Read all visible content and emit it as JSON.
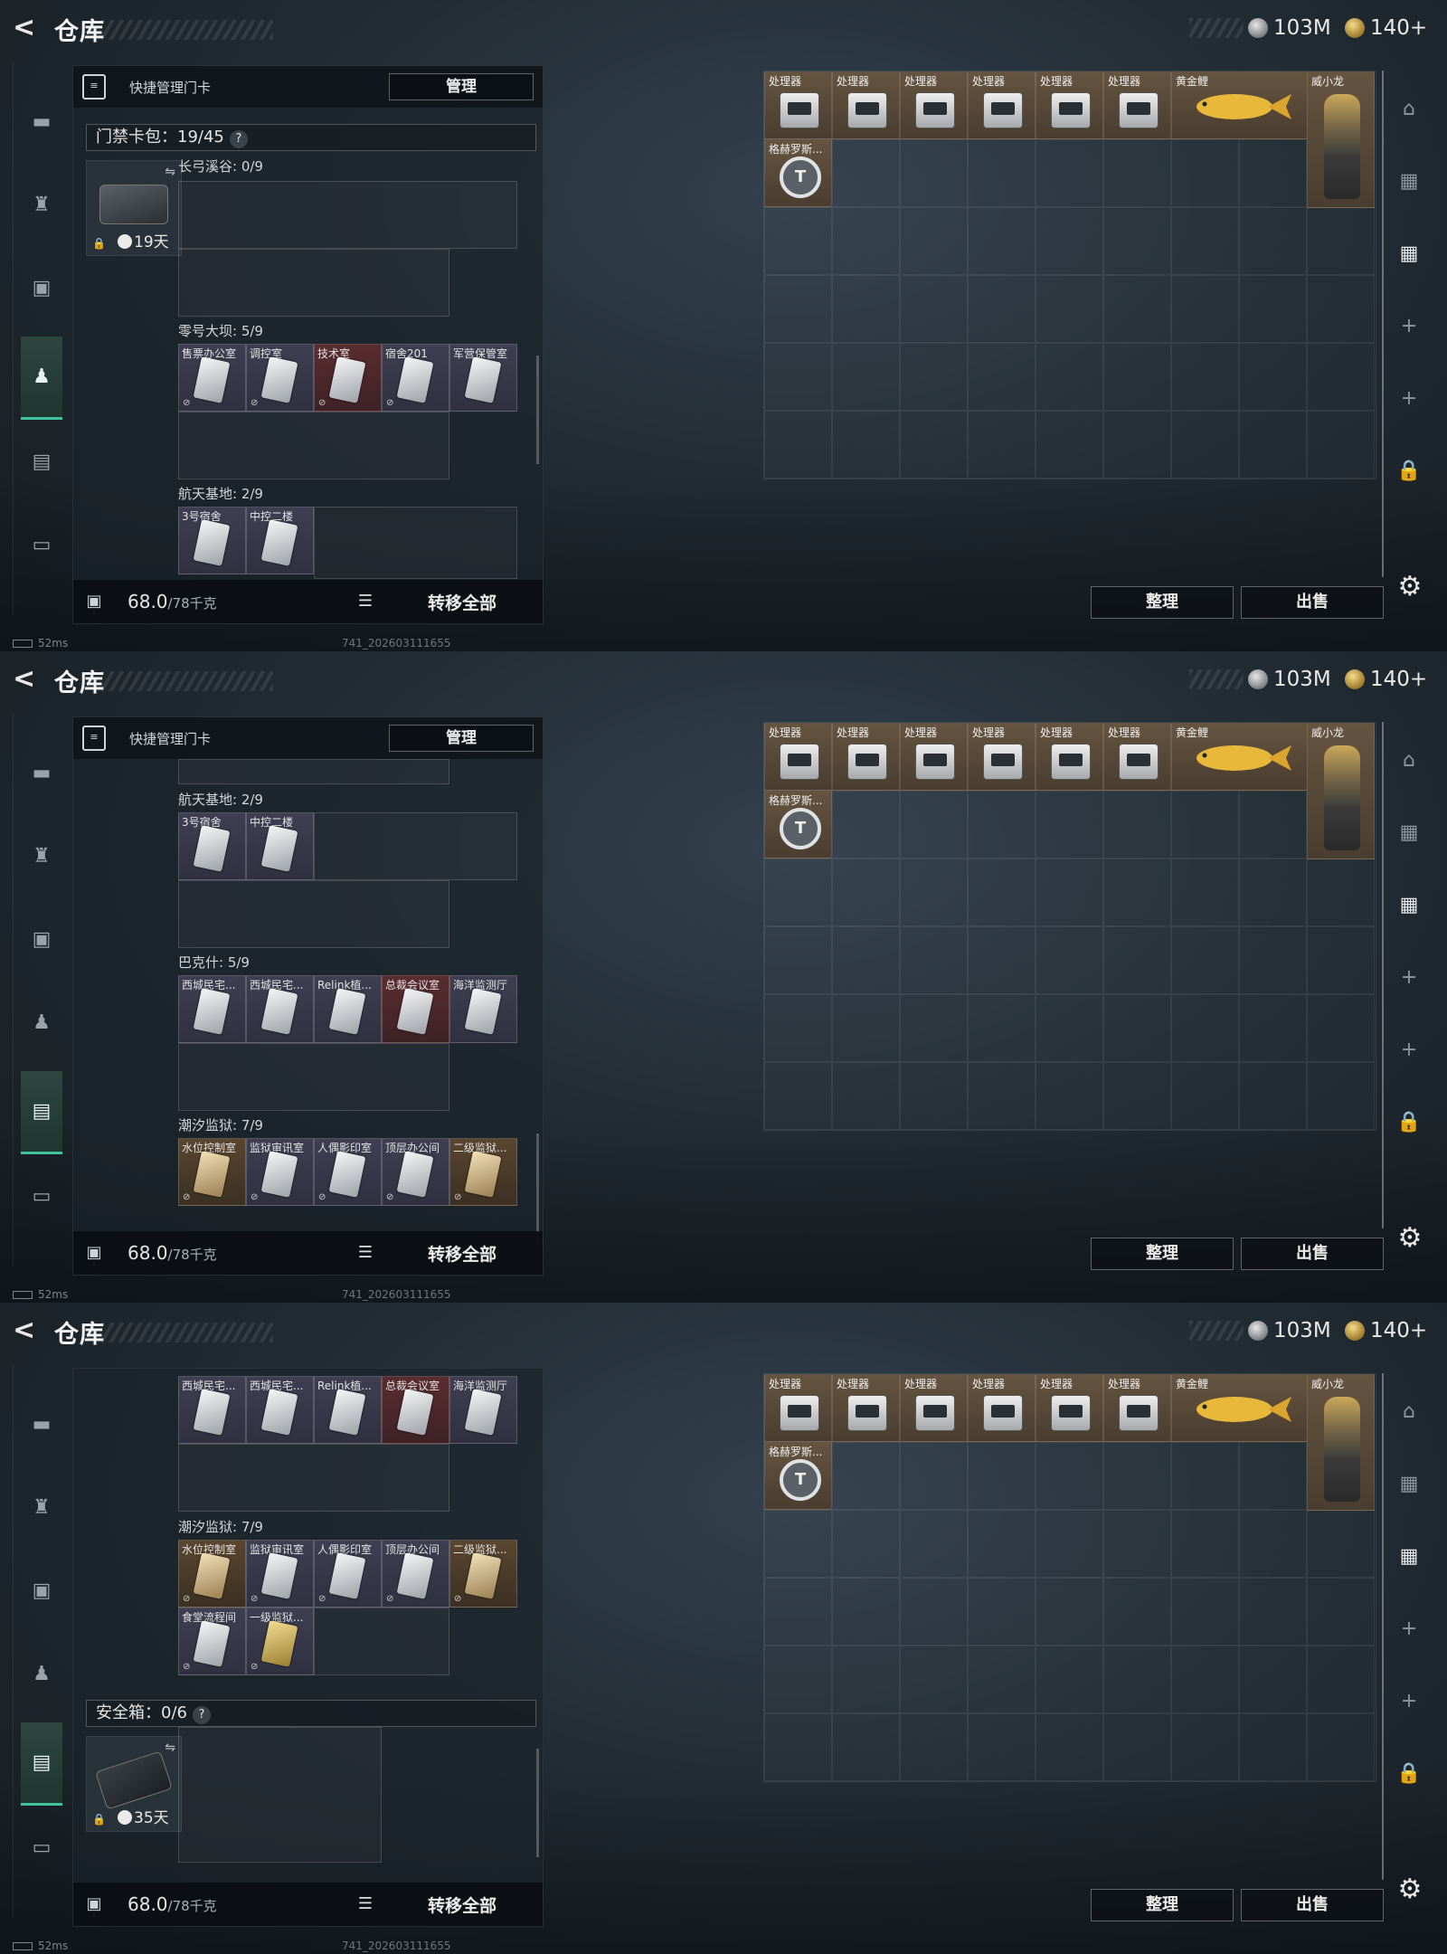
{
  "header": {
    "back": "<",
    "title": "仓库",
    "silver": "103M",
    "gold": "140+"
  },
  "left": {
    "quick_manage": "快捷管理门卡",
    "manage_btn": "管理",
    "cardbag_title": "门禁卡包：19/45",
    "cardbag_days": "19天",
    "safe_title": "安全箱：0/6",
    "safe_days": "35天",
    "help": "?",
    "weight": "68.0",
    "weight_cap": "/78千克",
    "transfer_all": "转移全部",
    "regions": {
      "r1": "长弓溪谷: 0/9",
      "r2": "零号大坝: 5/9",
      "r3": "航天基地: 2/9",
      "r4": "巴克什: 5/9",
      "r5": "潮汐监狱: 7/9"
    },
    "cards_dam": [
      "售票办公室",
      "调控室",
      "技术室",
      "宿舍201",
      "军营保管室"
    ],
    "cards_space": [
      "3号宿舍",
      "中控二楼"
    ],
    "cards_bak": [
      "西城民宅...",
      "西城民宅...",
      "Relink植...",
      "总裁会议室",
      "海洋监测厅"
    ],
    "cards_tide": [
      "水位控制室",
      "监狱审讯室",
      "人偶影印室",
      "顶层办公间",
      "二级监狱...",
      "食堂流程间",
      "一级监狱..."
    ]
  },
  "right": {
    "processor": "处理器",
    "fish": "黄金鲤",
    "figure": "威小龙",
    "medal": "格赫罗斯...",
    "sort_btn": "整理",
    "sell_btn": "出售"
  },
  "status": {
    "ping": "52ms",
    "build": "741_202603111655"
  }
}
